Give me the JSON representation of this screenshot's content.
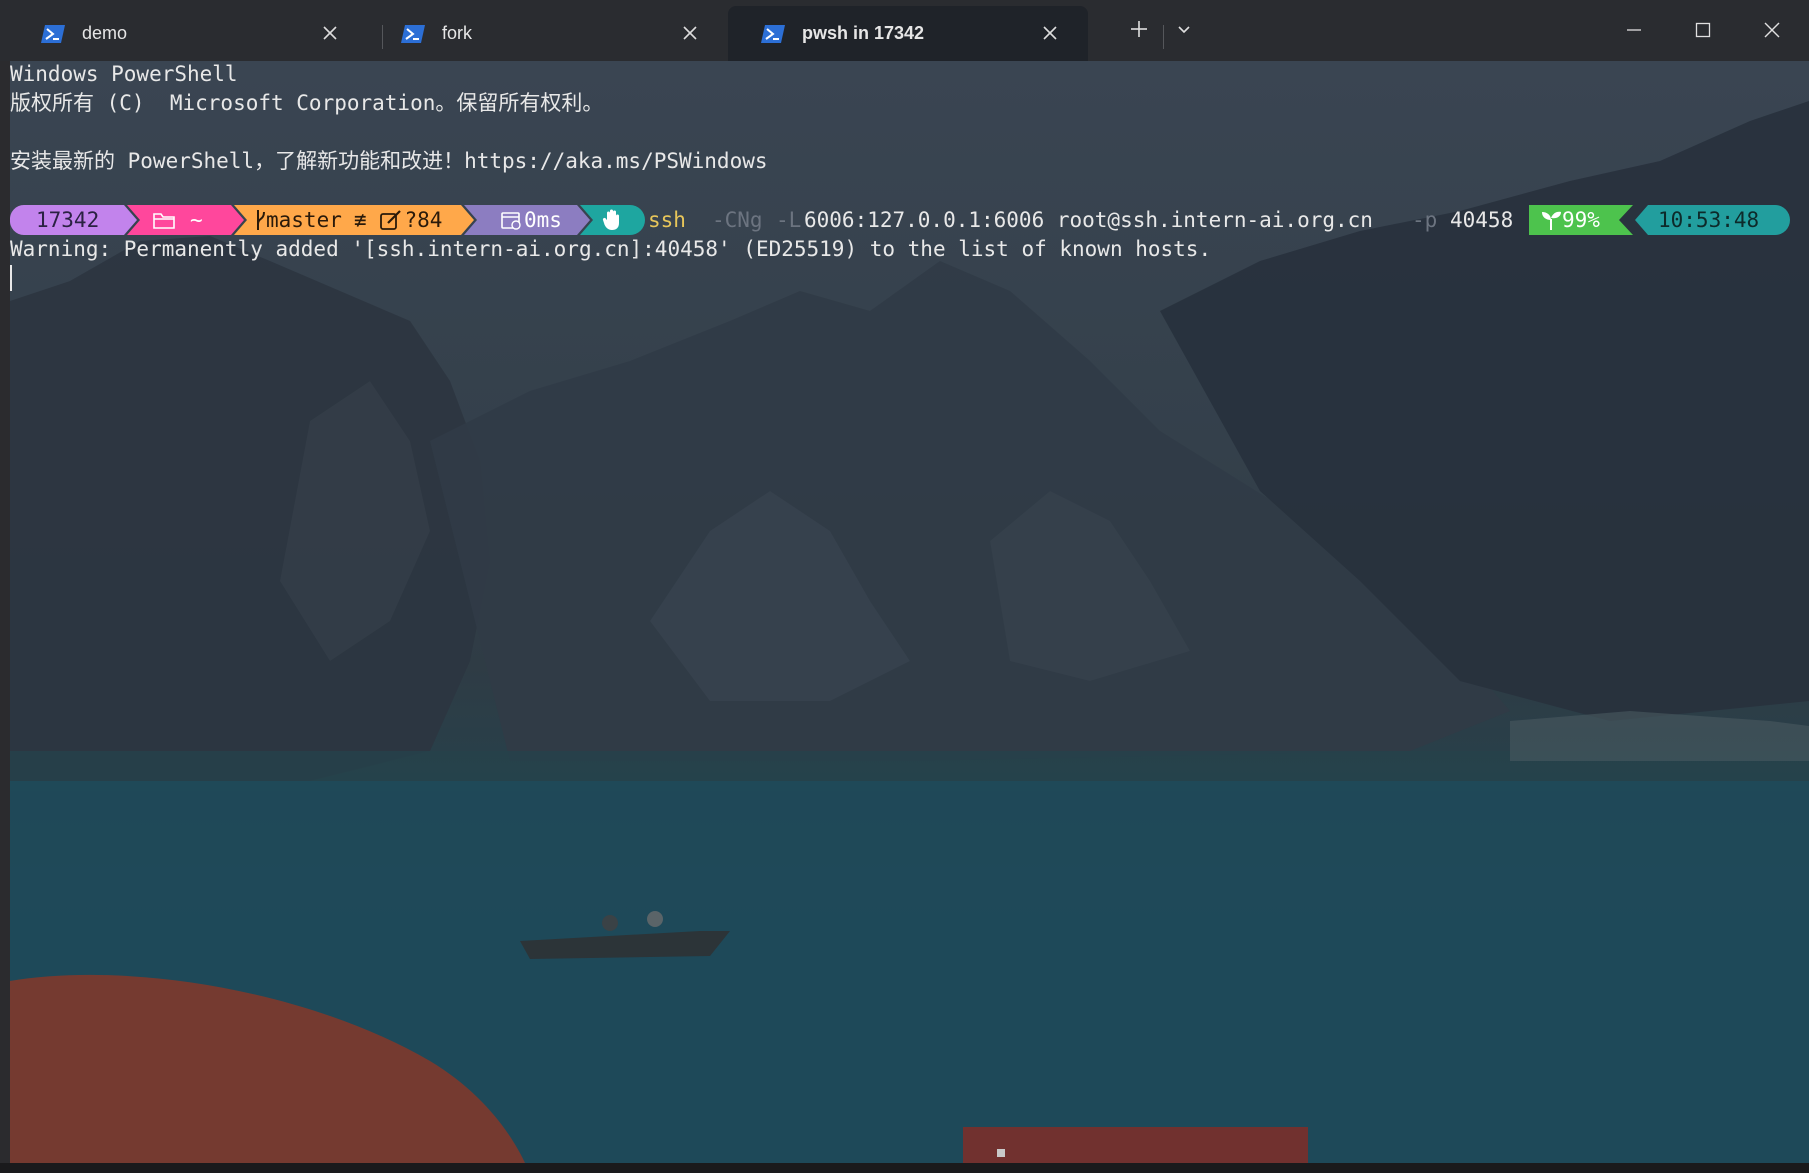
{
  "tabs": [
    {
      "label": "demo",
      "active": false,
      "icon": "powershell-icon"
    },
    {
      "label": "fork",
      "active": false,
      "icon": "powershell-icon"
    },
    {
      "label": "pwsh in 17342",
      "active": true,
      "icon": "powershell-icon"
    }
  ],
  "terminal": {
    "line1": "Windows PowerShell",
    "line2": "版权所有 (C)  Microsoft Corporation。保留所有权利。",
    "line3": "安装最新的 PowerShell，了解新功能和改进！https://aka.ms/PSWindows",
    "prompt": {
      "session": "17342",
      "path": "~",
      "git_branch": "master",
      "git_status": "≢",
      "git_changes": "?84",
      "exec_time": "0ms",
      "battery": "99%",
      "time": "10:53:48"
    },
    "command": {
      "name": "ssh",
      "flag1": "-CNg",
      "flag2": "-L",
      "arg1": "6006:127.0.0.1:6006 root@ssh.intern-ai.org.cn",
      "flag3": "-p",
      "arg2": "40458"
    },
    "warning": "Warning: Permanently added '[ssh.intern-ai.org.cn]:40458' (ED25519) to the list of known hosts."
  },
  "colors": {
    "seg_session": "#c283ec",
    "seg_path": "#ff479c",
    "seg_git": "#ffa84a",
    "seg_exec": "#8c7dc1",
    "seg_shell": "#1ea6a0",
    "seg_battery": "#4dc34d",
    "seg_time": "#229e9e",
    "cmd_name": "#e8c65a",
    "cmd_flag": "#6c7480"
  }
}
